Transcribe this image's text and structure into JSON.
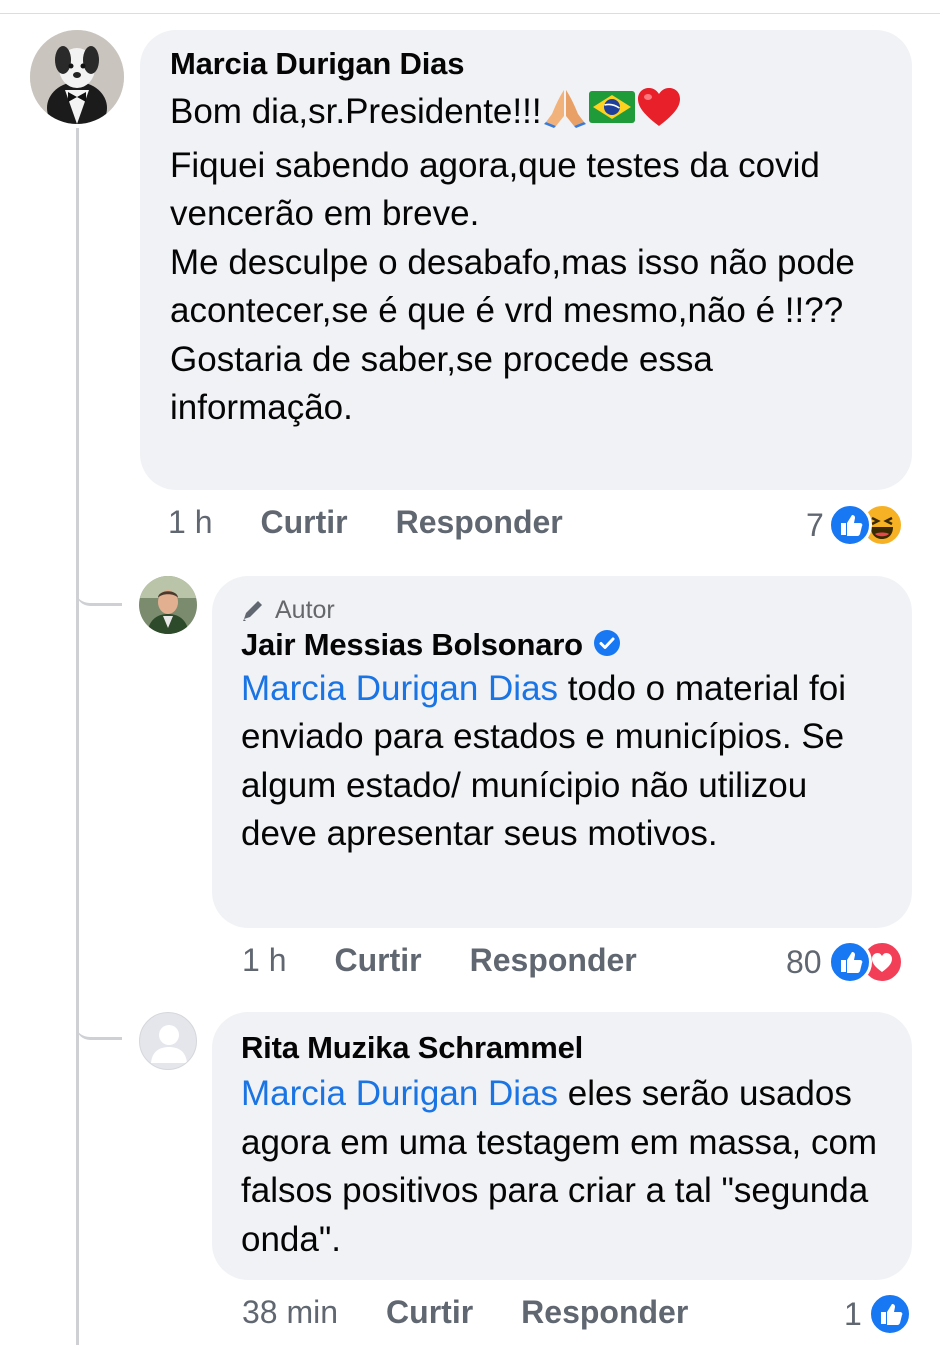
{
  "comment": {
    "author": "Marcia Durigan Dias",
    "text_line1": "Bom dia,sr.Presidente!!!",
    "emojis": [
      "praying-hands-icon",
      "brazil-flag-icon",
      "red-heart-icon"
    ],
    "text_rest": "Fiquei sabendo agora,que testes da covid vencerão em breve.\nMe desculpe o desabafo,mas isso não pode acontecer,se é que é vrd mesmo,não é !!??\nGostaria de saber,se procede essa informação.",
    "time": "1 h",
    "like_label": "Curtir",
    "reply_label": "Responder",
    "reaction_count": "7",
    "reaction_icons": [
      "like-icon",
      "haha-icon"
    ]
  },
  "reply1": {
    "badge": "Autor",
    "author": "Jair Messias Bolsonaro",
    "mention": "Marcia Durigan Dias",
    "text": " todo o material foi enviado para estados e municípios. Se algum estado/ munícipio não utilizou deve apresentar seus motivos.",
    "time": "1 h",
    "like_label": "Curtir",
    "reply_label": "Responder",
    "reaction_count": "80",
    "reaction_icons": [
      "like-icon",
      "love-icon"
    ]
  },
  "reply2": {
    "author": "Rita Muzika Schrammel",
    "mention": "Marcia Durigan Dias",
    "text": " eles serão usados agora em uma testagem em massa, com falsos positivos para criar a tal \"segunda onda\".",
    "time": "38 min",
    "like_label": "Curtir",
    "reply_label": "Responder",
    "reaction_count": "1",
    "reaction_icons": [
      "like-icon"
    ]
  },
  "colors": {
    "link": "#1b74e4",
    "bubble": "#f0f2f5",
    "meta": "#606770",
    "like": "#1877f2",
    "love": "#f33e58"
  }
}
